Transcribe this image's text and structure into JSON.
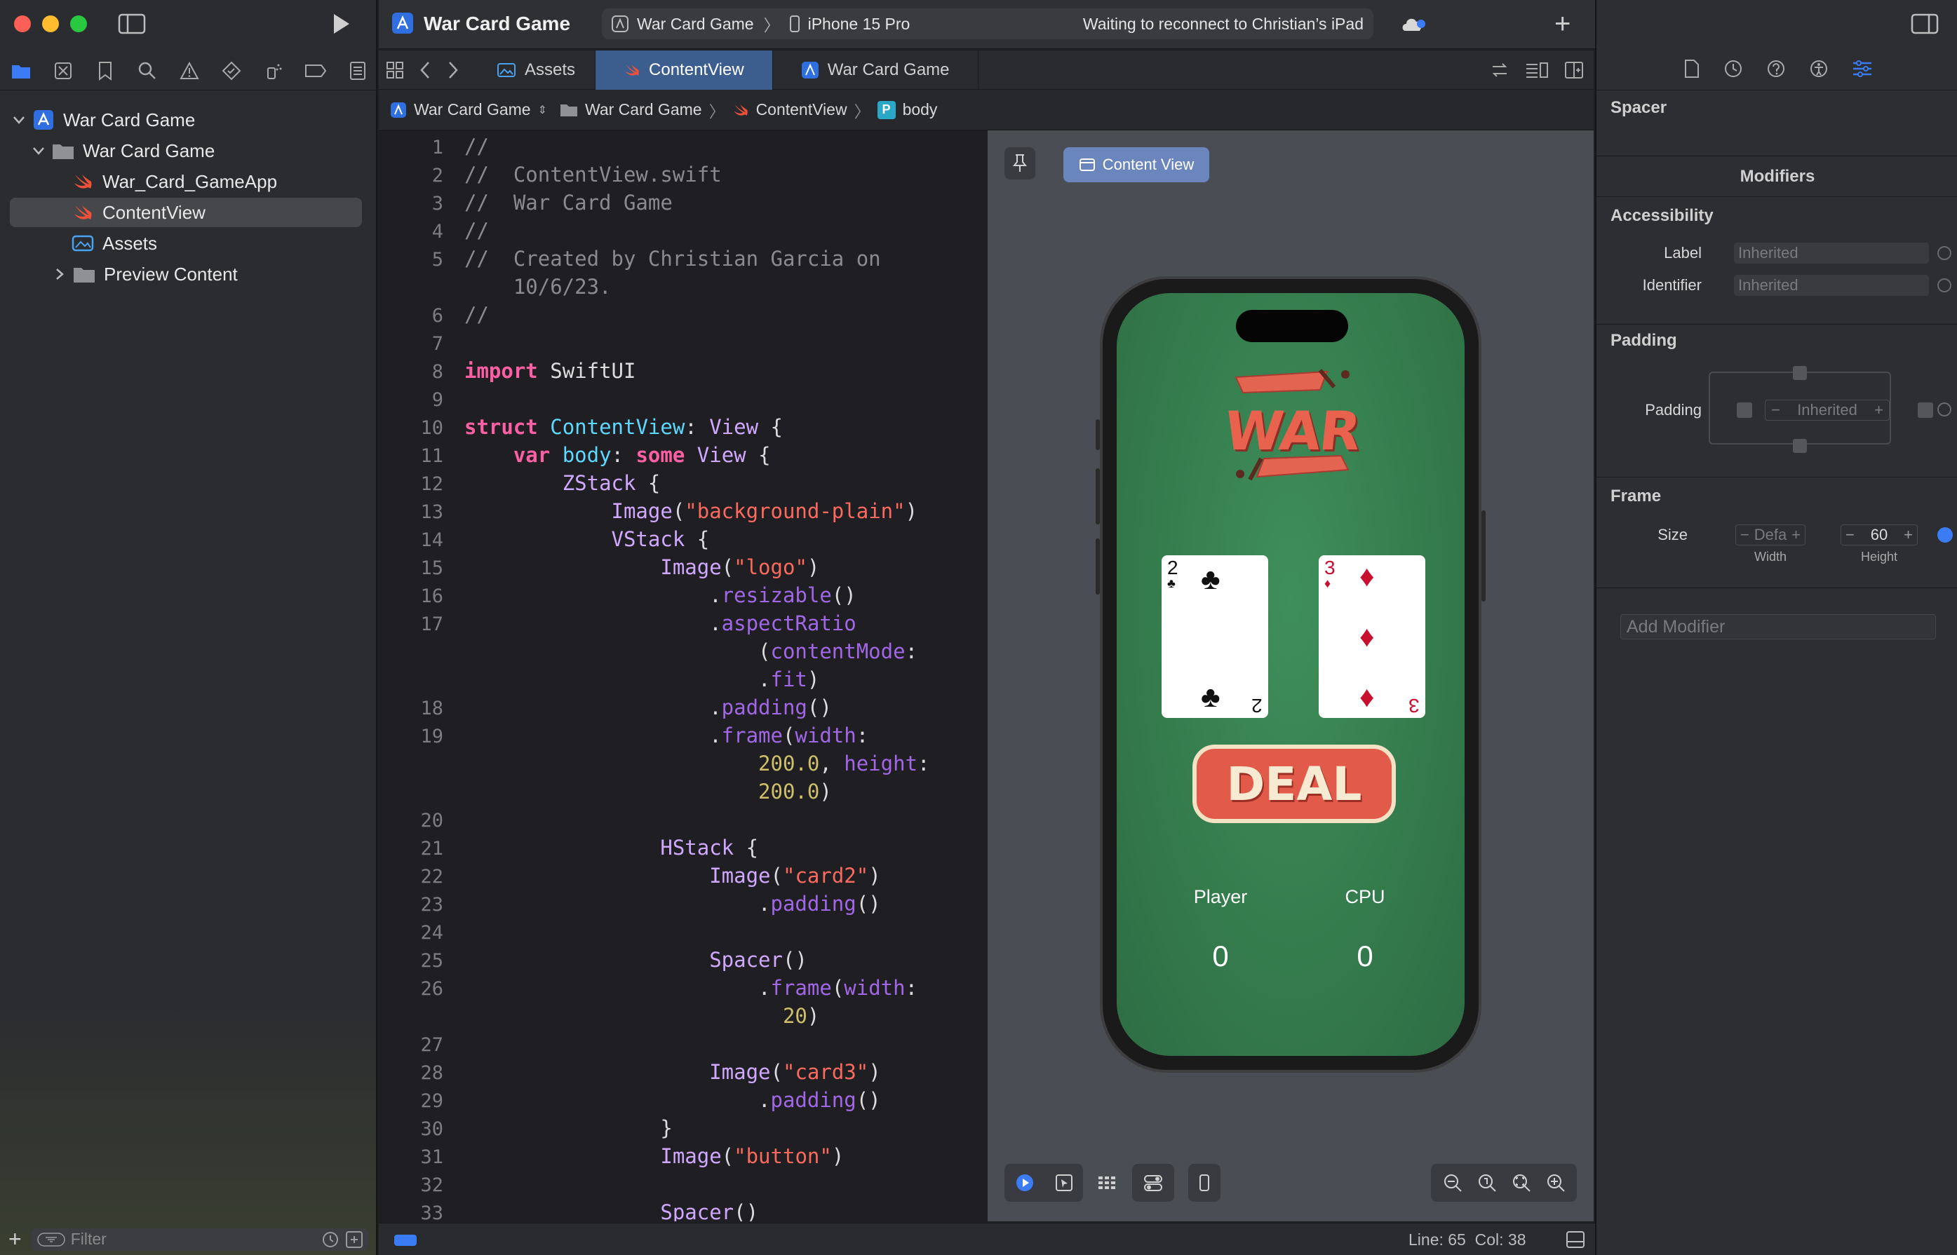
{
  "window": {
    "title": "War Card Game"
  },
  "toolbar": {
    "scheme_project": "War Card Game",
    "scheme_device": "iPhone 15 Pro",
    "status_message": "Waiting to reconnect to Christian’s iPad"
  },
  "navigator": {
    "items": [
      {
        "label": "War Card Game"
      },
      {
        "label": "War Card Game"
      },
      {
        "label": "War_Card_GameApp"
      },
      {
        "label": "ContentView"
      },
      {
        "label": "Assets"
      },
      {
        "label": "Preview Content"
      }
    ],
    "filter_placeholder": "Filter"
  },
  "tabs": [
    {
      "label": "Assets"
    },
    {
      "label": "ContentView"
    },
    {
      "label": "War Card Game"
    }
  ],
  "jumpbar": {
    "project": "War Card Game",
    "group": "War Card Game",
    "file": "ContentView",
    "symbol_badge": "P",
    "symbol": "body"
  },
  "code": {
    "line_numbers": [
      "1",
      "2",
      "3",
      "4",
      "5",
      "6",
      "7",
      "8",
      "9",
      "10",
      "11",
      "12",
      "13",
      "14",
      "15",
      "16",
      "17",
      "18",
      "19",
      "20",
      "21",
      "22",
      "23",
      "24",
      "25",
      "26",
      "27",
      "28",
      "29",
      "30",
      "31",
      "32",
      "33"
    ]
  },
  "preview": {
    "pin_label": "Content View",
    "logo_text": "WAR",
    "card_left": {
      "rank": "2",
      "suit": "♣"
    },
    "card_right": {
      "rank": "3",
      "suit": "♦"
    },
    "deal_label": "DEAL",
    "player_label": "Player",
    "cpu_label": "CPU",
    "player_score": "0",
    "cpu_score": "0"
  },
  "inspector": {
    "selection_title": "Spacer",
    "modifiers_title": "Modifiers",
    "accessibility_title": "Accessibility",
    "label_caption": "Label",
    "label_value": "Inherited",
    "identifier_caption": "Identifier",
    "identifier_value": "Inherited",
    "padding_title": "Padding",
    "padding_caption": "Padding",
    "padding_value": "Inherited",
    "frame_title": "Frame",
    "size_caption": "Size",
    "width_value": "Defa",
    "height_value": "60",
    "width_caption": "Width",
    "height_caption": "Height",
    "add_modifier_placeholder": "Add Modifier"
  },
  "statusbar": {
    "position": "Line: 65  Col: 38"
  },
  "colors": {
    "accent": "#3b7cf5",
    "selected_tab": "#3b5e8f",
    "table_green": "#3f8f5a",
    "deal_red": "#e25a4a"
  }
}
